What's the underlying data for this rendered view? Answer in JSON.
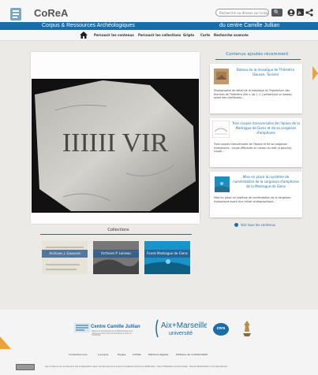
{
  "header": {
    "brand": "CoReA",
    "search_placeholder": "Recherche au-dessus sur la base",
    "subtitle_left": "Corpus & Ressources Archéologiques",
    "subtitle_right": "du centre Camille Jullian",
    "accent": "#1a6da6"
  },
  "nav": {
    "items": [
      "Parcourir les contenus",
      "Parcourir les collections",
      "Gripto",
      "Carte",
      "Recherche avancée"
    ]
  },
  "main": {
    "image_inscription": "IIIIII VIR"
  },
  "recent": {
    "title": "Contenus ajoutés récemment",
    "items": [
      {
        "title": "Bateau de la mosaïque de Thémétra (Sousse, Tunisie)",
        "text": "Photographie de détail de la mosaïque du Triglelarium des thermes de Thémétra (IIIe s. ap. J.-C.) présentant un bateau ayant des similitudes..."
      },
      {
        "title": "Trois coupes transversales de l'épave de la Madrague de Giens et de sa cargaison d'amphores",
        "text": "Trois coupes transversales de l'épave et de sa cargaison d'amphores ; coupe effectuée au niveau du mât (à gauche), coupe..."
      },
      {
        "title": "Mise en place du système de numérotation de la cargaison d'amphores de la Madrague de Giens",
        "text": "Mise en place du système de numérotation de la cargaison d'amphores avant leur retrait stratigraphique..."
      }
    ],
    "see_all": "Voir tous les contenus"
  },
  "collections": {
    "title": "Collections",
    "items": [
      {
        "label": "Archives J. Gassend"
      },
      {
        "label": "Archives P. Loiseau"
      },
      {
        "label": "Fonds Madrague de Giens"
      }
    ]
  },
  "footer": {
    "ccj": "Centre Camille Jullian",
    "ccj_small": "Histoire et archéologie de la Méditerranée et de l'Afrique du Nord de la Protohistoire à la fin de l'Antiquité",
    "amu_line1": "Aix+Marseille",
    "amu_line2": "université",
    "cnrs": "cnrs",
    "links": [
      "Contactez-nous",
      "À propos",
      "Équipe",
      "Crédits",
      "Mentions légales",
      "Politique de confidentialité"
    ],
    "license": "Les contenus de ce site sont mis à disposition selon les termes de la Licence Creative Commons Attribution - Pas d'Utilisation Commerciale - Pas de Modification 4.0 International."
  }
}
